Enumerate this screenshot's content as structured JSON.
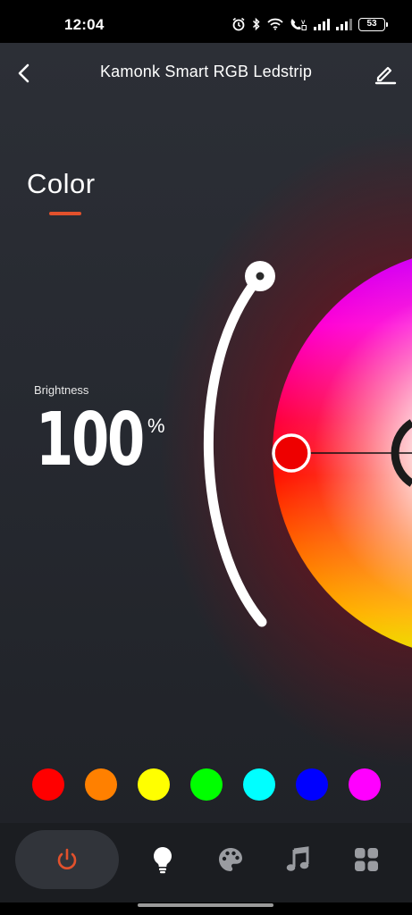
{
  "status_bar": {
    "time": "12:04",
    "battery": "53",
    "icons": [
      "alarm-icon",
      "bluetooth-icon",
      "wifi-icon",
      "volte-icon",
      "signal-icon",
      "signal-icon",
      "battery-icon"
    ]
  },
  "header": {
    "title": "Kamonk Smart RGB Ledstrip",
    "back_icon": "chevron-left-icon",
    "edit_icon": "pencil-icon"
  },
  "mode": {
    "title": "Color"
  },
  "brightness": {
    "label": "Brightness",
    "value": "100",
    "unit": "%",
    "level": 1.0
  },
  "color_wheel": {
    "selected_color": "#ff0000"
  },
  "preset_colors": [
    "#ff0000",
    "#ff8000",
    "#ffff00",
    "#00ff00",
    "#00ffff",
    "#0000ff",
    "#ff00ff"
  ],
  "nav": {
    "items": [
      {
        "name": "power",
        "icon": "power-icon",
        "active": true
      },
      {
        "name": "light",
        "icon": "bulb-icon",
        "active": false
      },
      {
        "name": "scenes",
        "icon": "palette-icon",
        "active": false
      },
      {
        "name": "music",
        "icon": "music-note-icon",
        "active": false
      },
      {
        "name": "more",
        "icon": "grid-icon",
        "active": false
      }
    ]
  },
  "colors": {
    "accent": "#e2512c",
    "nav_background": "#1b1d21",
    "screen_background": "#2a2d33"
  }
}
